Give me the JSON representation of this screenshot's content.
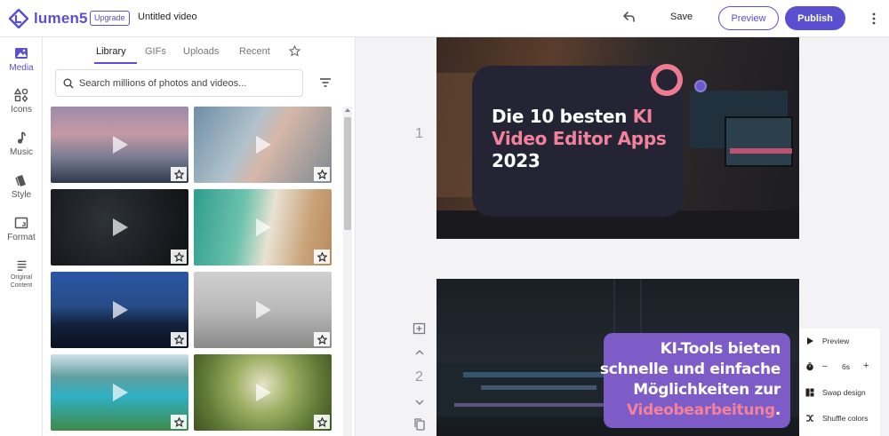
{
  "topbar": {
    "brand": "lumen5",
    "upgrade_label": "Upgrade",
    "document_title": "Untitled video",
    "save_label": "Save",
    "preview_label": "Preview",
    "publish_label": "Publish"
  },
  "rail": {
    "items": [
      {
        "label": "Media",
        "icon": "image-icon",
        "active": true
      },
      {
        "label": "Icons",
        "icon": "shapes-icon"
      },
      {
        "label": "Music",
        "icon": "music-note-icon"
      },
      {
        "label": "Style",
        "icon": "style-icon"
      },
      {
        "label": "Format",
        "icon": "format-icon"
      },
      {
        "label": "Original Content",
        "icon": "document-lines-icon"
      }
    ]
  },
  "media": {
    "tabs": [
      {
        "label": "Library",
        "active": true
      },
      {
        "label": "GIFs"
      },
      {
        "label": "Uploads"
      },
      {
        "label": "Recent"
      }
    ],
    "favorites_tab_icon": "star-icon",
    "search": {
      "placeholder": "Search millions of photos and videos...",
      "value": ""
    },
    "filter_icon": "filter-icon"
  },
  "scenes": [
    {
      "number": "1",
      "lines": [
        [
          {
            "t": "Die 10 besten "
          },
          {
            "t": "KI",
            "hl": true
          }
        ],
        [
          {
            "t": "Video Editor Apps",
            "hl": true
          }
        ],
        [
          {
            "t": "2023"
          }
        ]
      ]
    },
    {
      "number": "2",
      "lines": [
        [
          {
            "t": "KI-Tools bieten"
          }
        ],
        [
          {
            "t": "schnelle und einfache"
          }
        ],
        [
          {
            "t": "Möglichkeiten zur"
          }
        ],
        [
          {
            "t": "Videobearbeitung",
            "hl": true
          },
          {
            "t": "."
          }
        ]
      ]
    }
  ],
  "scene_options": {
    "preview_label": "Preview",
    "duration_value": "6s",
    "minus_label": "–",
    "plus_label": "+",
    "swap_label": "Swap design",
    "shuffle_label": "Shuffle colors"
  },
  "colors": {
    "accent": "#5a4fcf",
    "highlight_pink": "#f2829c",
    "card_dark": "#242434",
    "card_purple": "#7d5cc7"
  }
}
